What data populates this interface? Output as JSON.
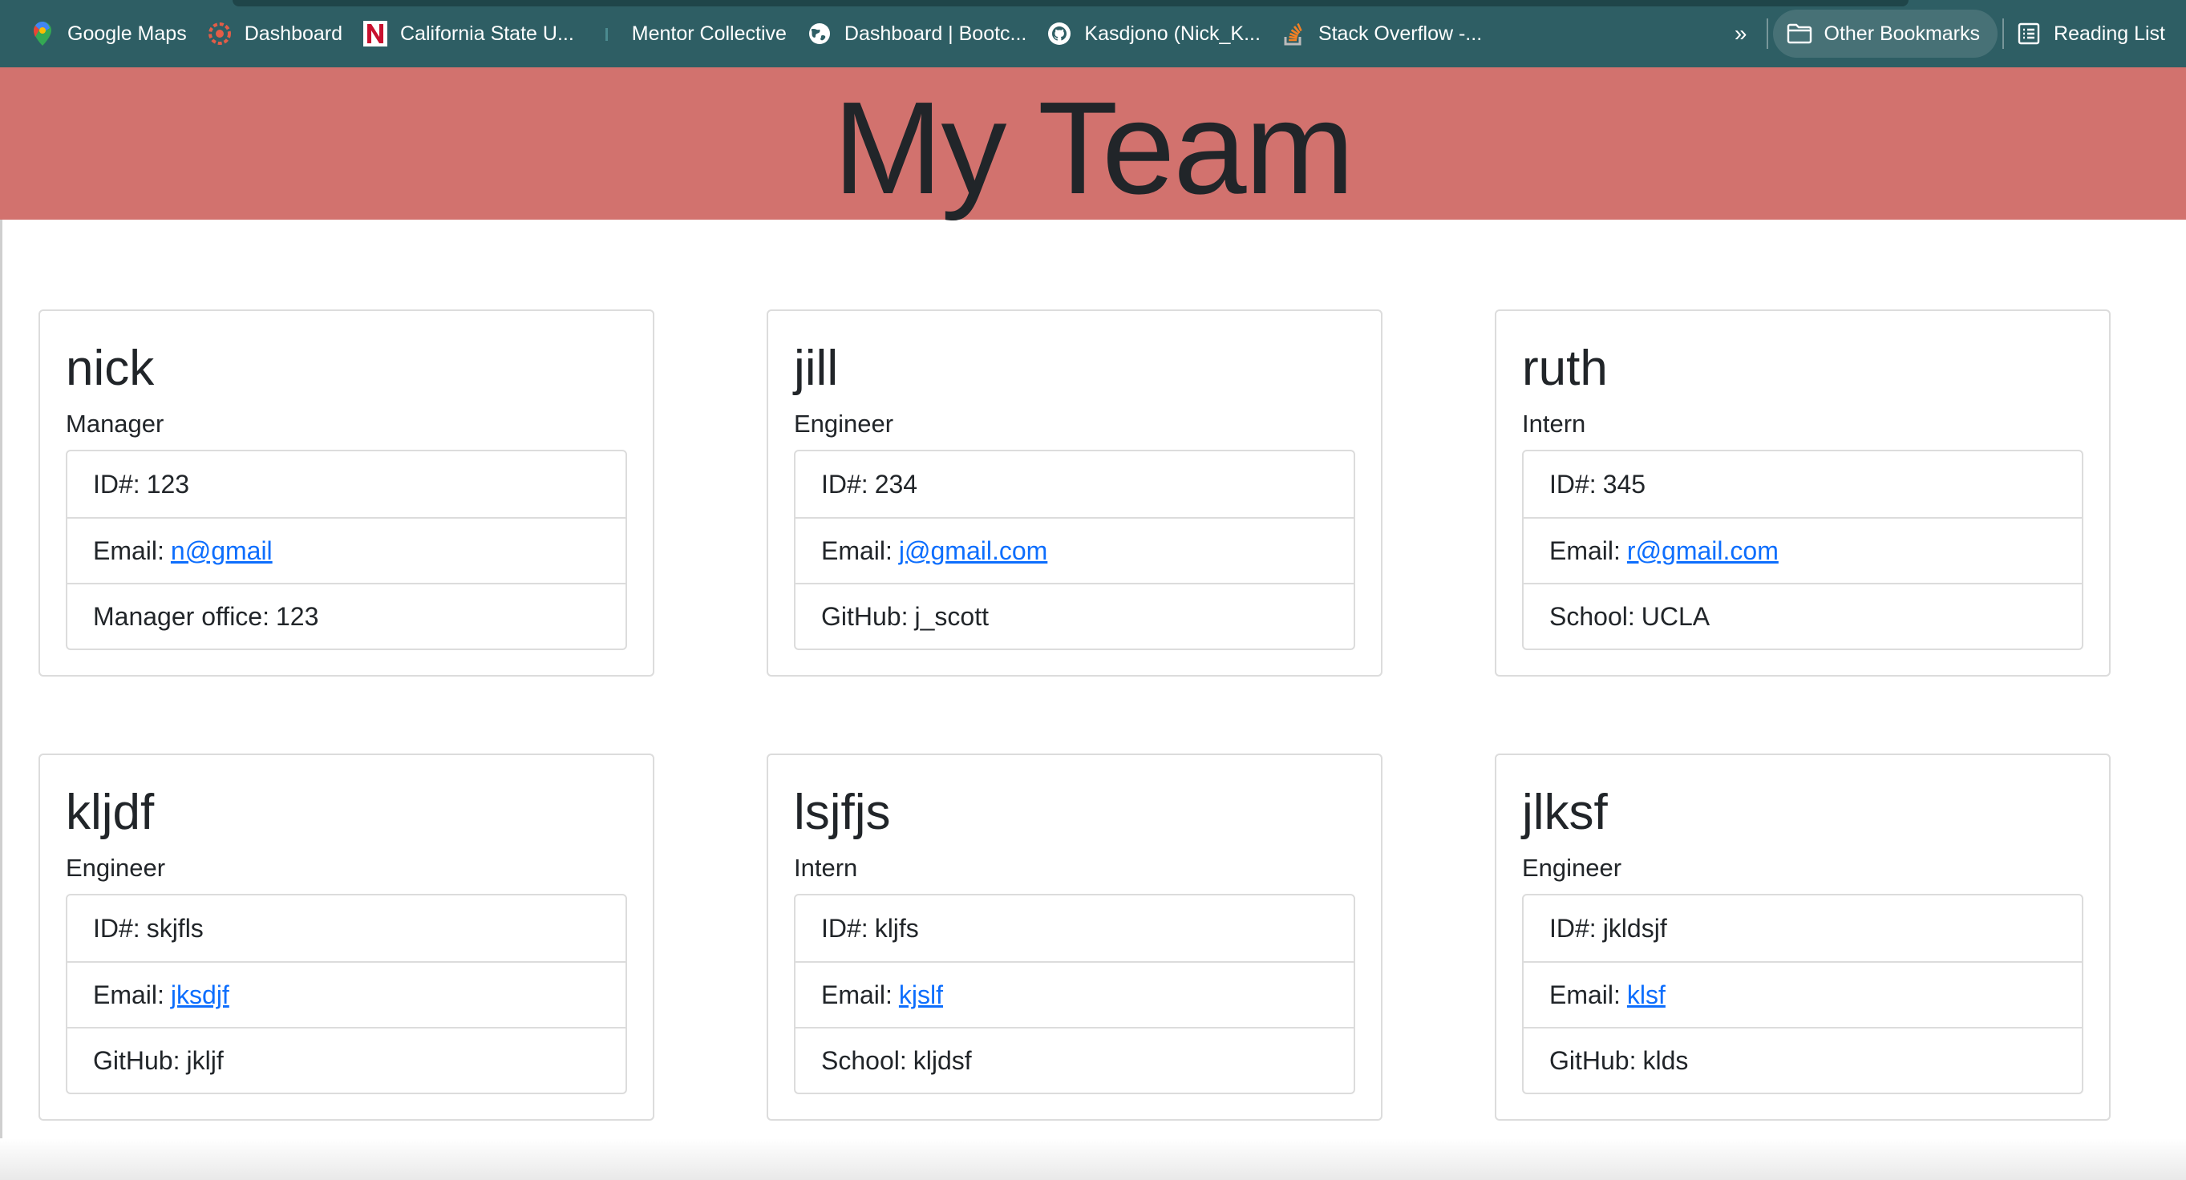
{
  "bookmarks": {
    "items": [
      {
        "label": "Google Maps",
        "icon": "google-maps-icon"
      },
      {
        "label": "Dashboard",
        "icon": "dashboard-icon"
      },
      {
        "label": "California State U...",
        "icon": "csu-icon"
      },
      {
        "label": "Mentor Collective",
        "icon": "mentor-collective-icon"
      },
      {
        "label": "Dashboard | Bootc...",
        "icon": "globe-icon"
      },
      {
        "label": "Kasdjono (Nick_K...",
        "icon": "github-icon"
      },
      {
        "label": "Stack Overflow -...",
        "icon": "stack-overflow-icon"
      }
    ],
    "more": "»",
    "other_bookmarks": "Other Bookmarks",
    "reading_list": "Reading List"
  },
  "header": {
    "title": "My Team"
  },
  "team": [
    {
      "name": "nick",
      "role": "Manager",
      "id_label": "ID#:",
      "id": "123",
      "email_label": "Email:",
      "email": "n@gmail",
      "extra_label": "Manager office:",
      "extra": "123"
    },
    {
      "name": "jill",
      "role": "Engineer",
      "id_label": "ID#:",
      "id": "234",
      "email_label": "Email:",
      "email": "j@gmail.com",
      "extra_label": "GitHub:",
      "extra": "j_scott"
    },
    {
      "name": "ruth",
      "role": "Intern",
      "id_label": "ID#:",
      "id": "345",
      "email_label": "Email:",
      "email": "r@gmail.com",
      "extra_label": "School:",
      "extra": "UCLA"
    },
    {
      "name": "kljdf",
      "role": "Engineer",
      "id_label": "ID#:",
      "id": "skjfls",
      "email_label": "Email:",
      "email": "jksdjf",
      "extra_label": "GitHub:",
      "extra": "jkljf"
    },
    {
      "name": "lsjfjs",
      "role": "Intern",
      "id_label": "ID#:",
      "id": "kljfs",
      "email_label": "Email:",
      "email": "kjslf",
      "extra_label": "School:",
      "extra": "kljdsf"
    },
    {
      "name": "jlksf",
      "role": "Engineer",
      "id_label": "ID#:",
      "id": "jkldsjf",
      "email_label": "Email:",
      "email": "klsf",
      "extra_label": "GitHub:",
      "extra": "klds"
    }
  ],
  "colors": {
    "bookmarks_bar": "#2e5e64",
    "header_bg": "#d2726e",
    "link": "#0d6efd"
  }
}
